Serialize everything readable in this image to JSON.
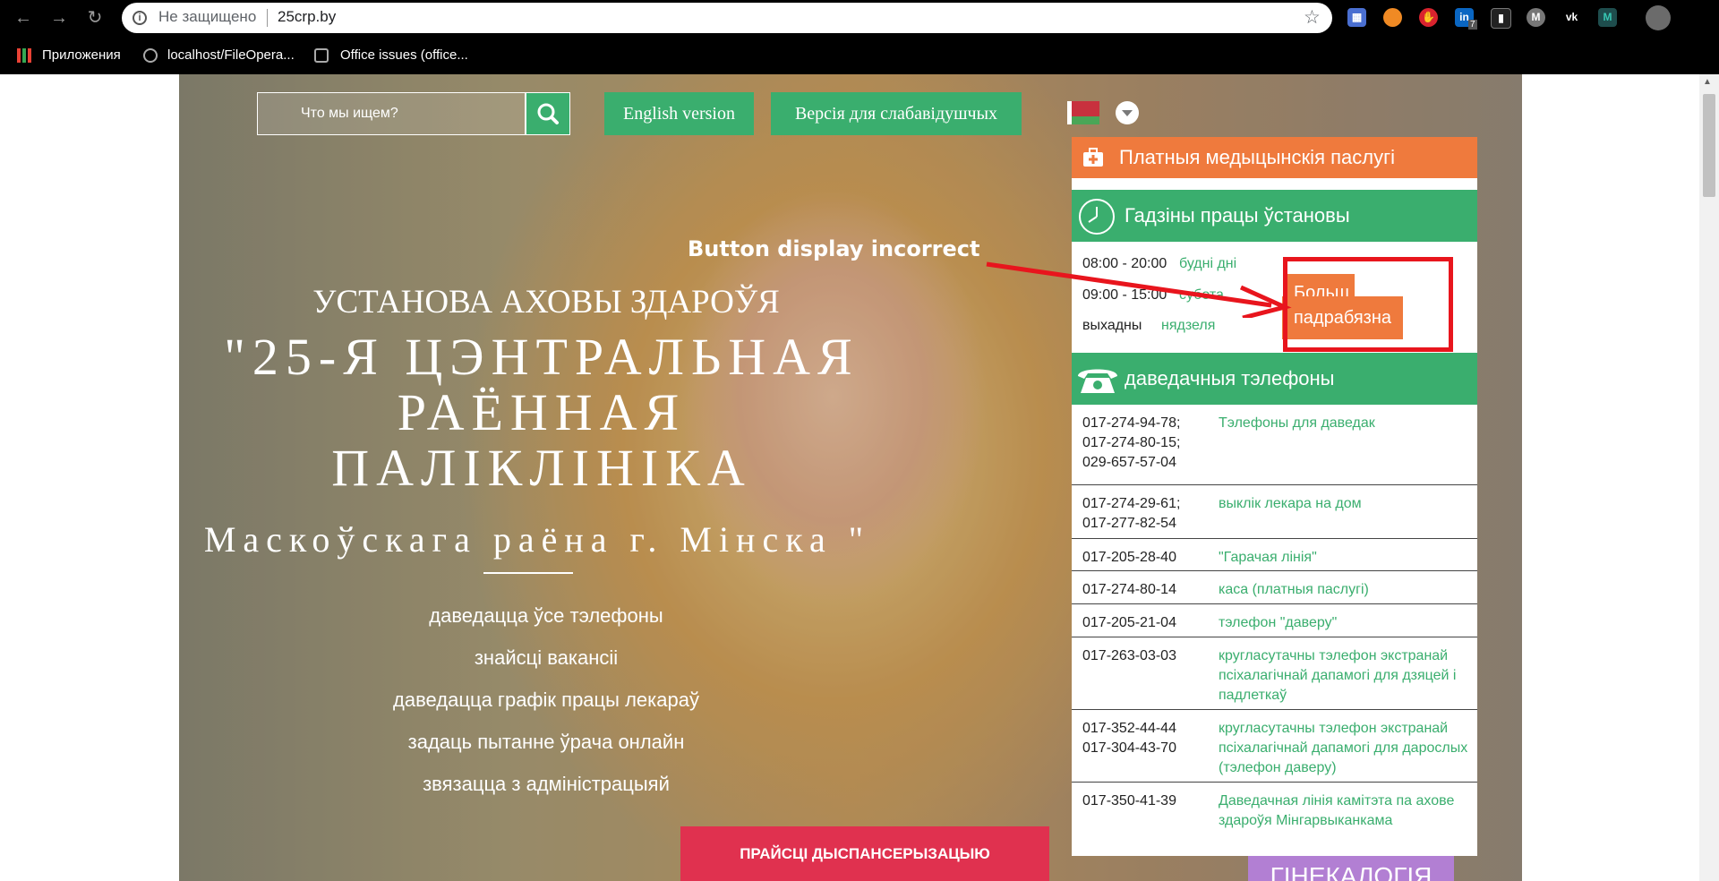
{
  "browser": {
    "security_label": "Не защищено",
    "url": "25crp.by",
    "bookmarks": [
      {
        "label": "Приложения"
      },
      {
        "label": "localhost/FileOpera..."
      },
      {
        "label": "Office issues (office..."
      }
    ],
    "extension_badge": "7"
  },
  "header": {
    "search_placeholder": "Что мы ищем?",
    "english_version": "English version",
    "low_vision_version": "Версія для слабавідушчых"
  },
  "hero": {
    "title_line1": "УСТАНОВА АХОВЫ ЗДАРОЎЯ",
    "title_line2": "\"25-Я ЦЭНТРАЛЬНАЯ РАЁННАЯ ПАЛІКЛІНІКА",
    "title_line3": "Маскоўскага раёна г. Мінска \"",
    "links": [
      "даведацца ўсе тэлефоны",
      "знайсці вакансіі",
      "даведацца графік працы лекараў",
      "задаць пытанне ўрача онлайн",
      "звязацца з адміністрацыяй"
    ],
    "exam_button": "ПРАЙСЦІ ДЫСПАНСЕРЫЗАЦЫЮ",
    "gyn_button": "ГІНЕКАЛОГІЯ"
  },
  "panel": {
    "paid_services": "Платныя медыцынскія паслугі",
    "hours_title": "Гадзіны працы ўстановы",
    "hours": [
      {
        "time": "08:00 - 20:00",
        "day": "будні дні"
      },
      {
        "time": "09:00 - 15:00",
        "day": "субота"
      },
      {
        "time": "выхадны",
        "day": "нядзеля"
      }
    ],
    "more_button_partial": "Больш",
    "more_button": "падрабязна",
    "phones_title": "даведачныя тэлефоны",
    "phones": [
      {
        "numbers": "017-274-94-78;\n017-274-80-15;\n029-657-57-04",
        "desc": "Тэлефоны для даведак"
      },
      {
        "numbers": "017-274-29-61;\n017-277-82-54",
        "desc": "выклік лекара на дом"
      },
      {
        "numbers": "017-205-28-40",
        "desc": "\"Гарачая лінія\""
      },
      {
        "numbers": "017-274-80-14",
        "desc": "каса (платныя паслугі)"
      },
      {
        "numbers": "017-205-21-04",
        "desc": "тэлефон \"даверу\""
      },
      {
        "numbers": "017-263-03-03",
        "desc": "кругласутачны тэлефон экстранай псіхалагічнай дапамогі для дзяцей і падлеткаў"
      },
      {
        "numbers": "017-352-44-44\n017-304-43-70",
        "desc": "кругласутачны тэлефон экстранай псіхалагічнай дапамогі для дарослых (тэлефон даверу)"
      },
      {
        "numbers": "017-350-41-39",
        "desc": "Даведачная лінія камітэта па ахове здароўя Мінгарвыканкама"
      }
    ]
  },
  "annotation": {
    "text": "Button display incorrect",
    "color": "#e8151d"
  },
  "colors": {
    "green": "#3aae6e",
    "orange": "#ef7a3d",
    "red_button": "#e0314f",
    "purple_button": "#b27fd3"
  }
}
